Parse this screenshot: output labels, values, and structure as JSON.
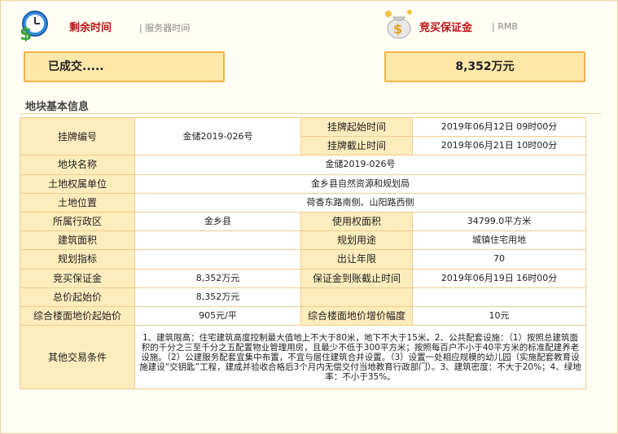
{
  "header": {
    "remaining_time_label": "剩余时间",
    "server_time_label": "| 服务器时间",
    "status_text": "已成交.....",
    "deposit_label": "竞买保证金",
    "deposit_unit": "| RMB",
    "deposit_value": "8,352万元"
  },
  "section": {
    "title": "地块基本信息"
  },
  "table": {
    "listing_no_label": "挂牌编号",
    "listing_no": "金储2019-026号",
    "start_time_label": "挂牌起始时间",
    "start_time": "2019年06月12日 09时00分",
    "end_time_label": "挂牌截止时间",
    "end_time": "2019年06月21日 10时00分",
    "parcel_name_label": "地块名称",
    "parcel_name": "金储2019-026号",
    "owner_label": "土地权属单位",
    "owner": "金乡县自然资源和规划局",
    "location_label": "土地位置",
    "location": "荷香东路南侧、山阳路西侧",
    "district_label": "所属行政区",
    "district": "金乡县",
    "use_area_label": "使用权面积",
    "use_area": "34799.0平方米",
    "building_area_label": "建筑面积",
    "building_area": "",
    "purpose_label": "规划用途",
    "purpose": "城镇住宅用地",
    "plan_index_label": "规划指标",
    "plan_index": "",
    "term_label": "出让年限",
    "term": "70",
    "deposit_label": "竞买保证金",
    "deposit": "8,352万元",
    "deposit_deadline_label": "保证金到账截止时间",
    "deposit_deadline": "2019年06月19日 16时00分",
    "start_price_label": "总价起始价",
    "start_price": "8,352万元",
    "floor_price_label": "综合楼面地价起始价",
    "floor_price": "905元/平",
    "increment_label": "综合楼面地价增价幅度",
    "increment": "10元",
    "conditions_label": "其他交易条件",
    "conditions": "1、建筑限高：住宅建筑高度控制最大值地上不大于80米，地下不大于15米。2、公共配套设施：（1）按照总建筑面积的千分之三至千分之五配置物业管理用房，且最少不低于300平方米；按照每百户不小于40平方米的标准配建养老设施。（2）公建服务配套宜集中布置，不宜与居住建筑合并设置。（3）设置一处相应规模的幼儿园（实施配套教育设施建设“交钥匙”工程，建成并验收合格后3个月内无偿交付当地教育行政部门）。3、建筑密度：不大于20%；4、绿地率：不小于35%。"
  },
  "colors": {
    "title_red": "#c0141a",
    "box_fill": "#fde8a9",
    "box_border": "#f2b24b",
    "label_fill": "#fdedbd",
    "cell_border": "#f3cb8e"
  }
}
